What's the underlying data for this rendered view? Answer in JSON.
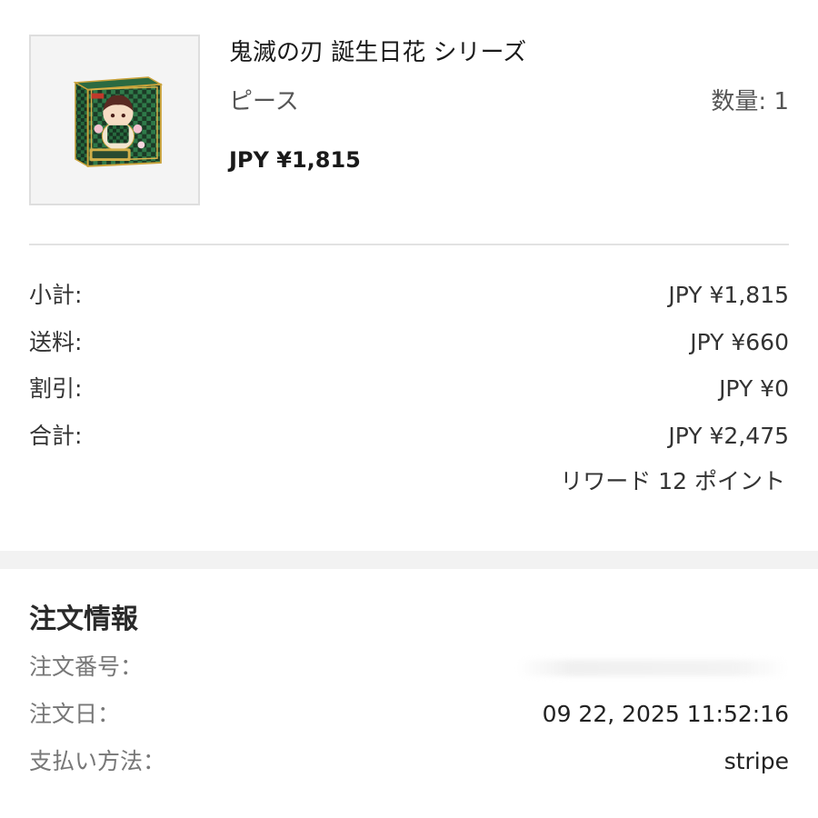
{
  "product": {
    "image_icon": "product-box-image",
    "name": "鬼滅の刃 誕生日花 シリーズ",
    "variant": "ピース",
    "quantity": "数量: 1",
    "price": "JPY ¥1,815"
  },
  "summary": {
    "subtotal_label": "小計:",
    "subtotal_value": "JPY ¥1,815",
    "shipping_label": "送料:",
    "shipping_value": "JPY ¥660",
    "discount_label": "割引:",
    "discount_value": "JPY ¥0",
    "total_label": "合計:",
    "total_value": "JPY ¥2,475",
    "reward": "リワード 12 ポイント"
  },
  "order_info": {
    "heading": "注文情報",
    "order_number_label": "注文番号：",
    "order_date_label": "注文日：",
    "order_date_value": "09 22, 2025 11:52:16",
    "payment_method_label": "支払い方法：",
    "payment_method_value": "stripe"
  },
  "colors": {
    "box_green": "#1f5a35",
    "box_gold": "#c9a23a",
    "divider": "#e2e2e2",
    "section_gap": "#f2f2f2"
  }
}
